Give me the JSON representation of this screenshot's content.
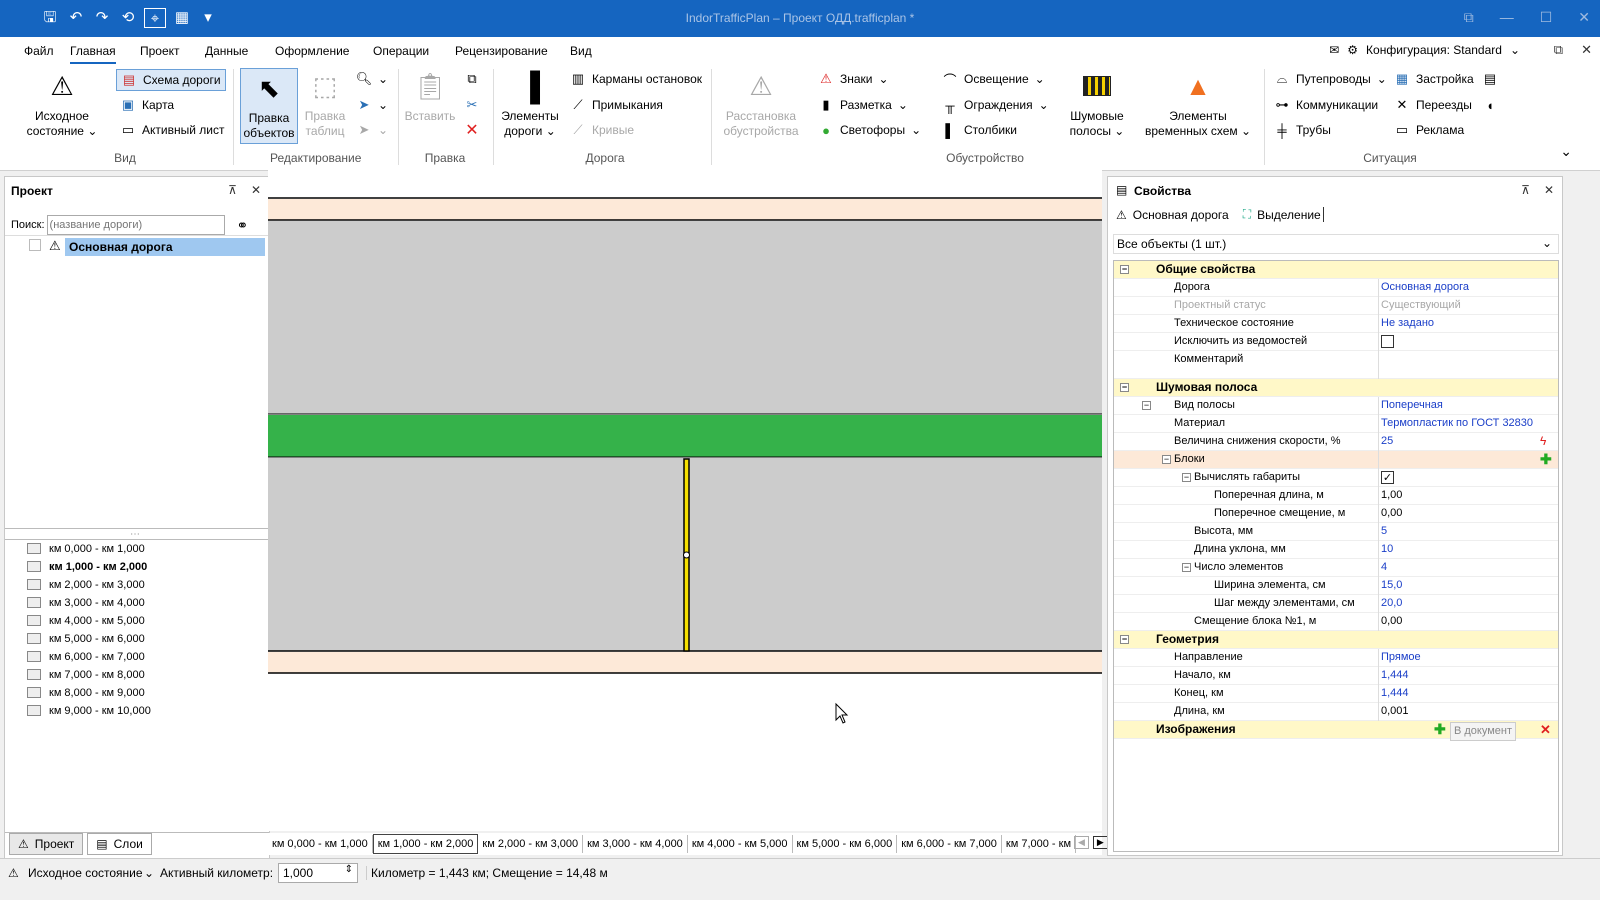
{
  "window": {
    "title": "IndorTrafficPlan – Проект ОДД.trafficplan *"
  },
  "menu": {
    "items": [
      "Файл",
      "Главная",
      "Проект",
      "Данные",
      "Оформление",
      "Операции",
      "Рецензирование",
      "Вид"
    ],
    "config": "Конфигурация: Standard"
  },
  "ribbon": {
    "vid": {
      "label": "Вид",
      "initial_state": "Исходное состояние",
      "road_scheme": "Схема дороги",
      "map": "Карта",
      "active_sheet": "Активный лист"
    },
    "edit": {
      "label": "Редактирование",
      "edit_objects": "Правка объектов",
      "edit_tables": "Правка таблиц"
    },
    "pravka": {
      "label": "Правка",
      "paste": "Вставить"
    },
    "road": {
      "label": "Дорога",
      "road_elements": "Элементы дороги",
      "bus_stops": "Карманы остановок",
      "junctions": "Примыкания",
      "curves": "Кривые"
    },
    "equip": {
      "label": "Обустройство",
      "placement": "Расстановка обустройства",
      "signs": "Знаки",
      "marking": "Разметка",
      "traffic_lights": "Светофоры",
      "lighting": "Освещение",
      "fencing": "Ограждения",
      "posts": "Столбики",
      "noise_strips": "Шумовые полосы",
      "temp_schemes": "Элементы временных схем"
    },
    "situation": {
      "label": "Ситуация",
      "overpasses": "Путепроводы",
      "communications": "Коммуникации",
      "pipes": "Трубы",
      "buildings": "Застройка",
      "crossings": "Переезды",
      "advertising": "Реклама"
    }
  },
  "project": {
    "title": "Проект",
    "search_label": "Поиск:",
    "search_placeholder": "(название дороги)",
    "road": "Основная дорога",
    "km_items": [
      "км 0,000 - км 1,000",
      "км 1,000 - км 2,000",
      "км 2,000 - км 3,000",
      "км 3,000 - км 4,000",
      "км 4,000 - км 5,000",
      "км 5,000 - км 6,000",
      "км 6,000 - км 7,000",
      "км 7,000 - км 8,000",
      "км 8,000 - км 9,000",
      "км 9,000 - км 10,000"
    ],
    "tabs": [
      "Проект",
      "Слои"
    ]
  },
  "km_tabs": [
    "км 0,000 - км 1,000",
    "км 1,000 - км 2,000",
    "км 2,000 - км 3,000",
    "км 3,000 - км 4,000",
    "км 4,000 - км 5,000",
    "км 5,000 - км 6,000",
    "км 6,000 - км 7,000",
    "км 7,000 - км"
  ],
  "properties": {
    "title": "Свойства",
    "tabs": [
      "Основная дорога",
      "Выделение"
    ],
    "selector": "Все объекты (1 шт.)",
    "rows": [
      {
        "type": "cat",
        "label": "Общие свойства",
        "indent": 0,
        "exp": "-"
      },
      {
        "label": "Дорога",
        "value": "Основная дорога",
        "indent": 1
      },
      {
        "label": "Проектный статус",
        "value": "Существующий",
        "indent": 1,
        "disabled": true
      },
      {
        "label": "Техническое состояние",
        "value": "Не задано",
        "indent": 1
      },
      {
        "label": "Исключить из ведомостей",
        "check": "",
        "indent": 1
      },
      {
        "label": "Комментарий",
        "value": "",
        "indent": 1,
        "tall": true
      },
      {
        "type": "cat",
        "label": "Шумовая полоса",
        "indent": 0,
        "exp": "-"
      },
      {
        "label": "Вид полосы",
        "value": "Поперечная",
        "indent": 1,
        "exp": "-"
      },
      {
        "label": "Материал",
        "value": "Термопластик по ГОСТ 32830",
        "indent": 2
      },
      {
        "label": "Величина снижения скорости, %",
        "value": "25",
        "indent": 2
      },
      {
        "label": "Блоки",
        "value": "",
        "indent": 2,
        "exp": "-",
        "hl": true
      },
      {
        "label": "Вычислять габариты",
        "check": "✓",
        "indent": 3,
        "exp": "-"
      },
      {
        "label": "Поперечная длина, м",
        "value": "1,00",
        "indent": 4,
        "black": true
      },
      {
        "label": "Поперечное смещение, м",
        "value": "0,00",
        "indent": 4,
        "black": true
      },
      {
        "label": "Высота, мм",
        "value": "5",
        "indent": 3
      },
      {
        "label": "Длина уклона, мм",
        "value": "10",
        "indent": 3
      },
      {
        "label": "Число элементов",
        "value": "4",
        "indent": 3,
        "exp": "-"
      },
      {
        "label": "Ширина элемента, см",
        "value": "15,0",
        "indent": 4
      },
      {
        "label": "Шаг между элементами, см",
        "value": "20,0",
        "indent": 4
      },
      {
        "label": "Смещение блока №1, м",
        "value": "0,00",
        "indent": 3,
        "black": true
      },
      {
        "type": "cat",
        "label": "Геометрия",
        "indent": 0,
        "exp": "-"
      },
      {
        "label": "Направление",
        "value": "Прямое",
        "indent": 1
      },
      {
        "label": "Начало, км",
        "value": "1,444",
        "indent": 1
      },
      {
        "label": "Конец, км",
        "value": "1,444",
        "indent": 1
      },
      {
        "label": "Длина, км",
        "value": "0,001",
        "indent": 1,
        "black": true
      },
      {
        "type": "cat",
        "label": "Изображения",
        "indent": 0,
        "exp": "",
        "extra": "В документ"
      }
    ]
  },
  "status": {
    "state": "Исходное состояние",
    "active_km_label": "Активный километр:",
    "active_km": "1,000",
    "position": "Километр = 1,443 км; Смещение = 14,48 м"
  },
  "colors": {
    "title": "#1565c0",
    "road": "#cccccc",
    "green": "#35b24a",
    "shoulder": "#fde9d8",
    "selected": "#9fc8f0"
  }
}
